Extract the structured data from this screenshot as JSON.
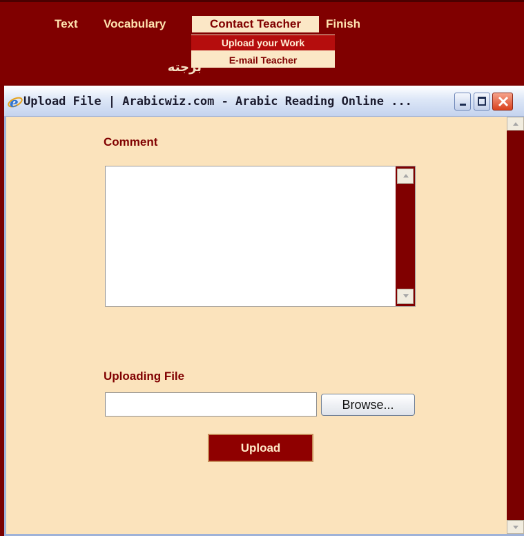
{
  "nav": {
    "items": [
      "Text",
      "Vocabulary",
      "Contact Teacher",
      "Finish"
    ],
    "dropdown": [
      "Upload your Work",
      "E-mail Teacher"
    ],
    "heading": "ﺑﺮﺟﺘﻪ"
  },
  "window": {
    "title": "Upload File | Arabicwiz.com - Arabic Reading Online ...",
    "icon": "internet-explorer-icon"
  },
  "form": {
    "comment_label": "Comment",
    "comment_value": "",
    "file_label": "Uploading File",
    "file_value": "",
    "browse_label": "Browse...",
    "upload_label": "Upload"
  },
  "colors": {
    "brand_maroon": "#800000",
    "content_bg": "#fbe3bc",
    "nav_active_bg": "#fbe7c6"
  }
}
